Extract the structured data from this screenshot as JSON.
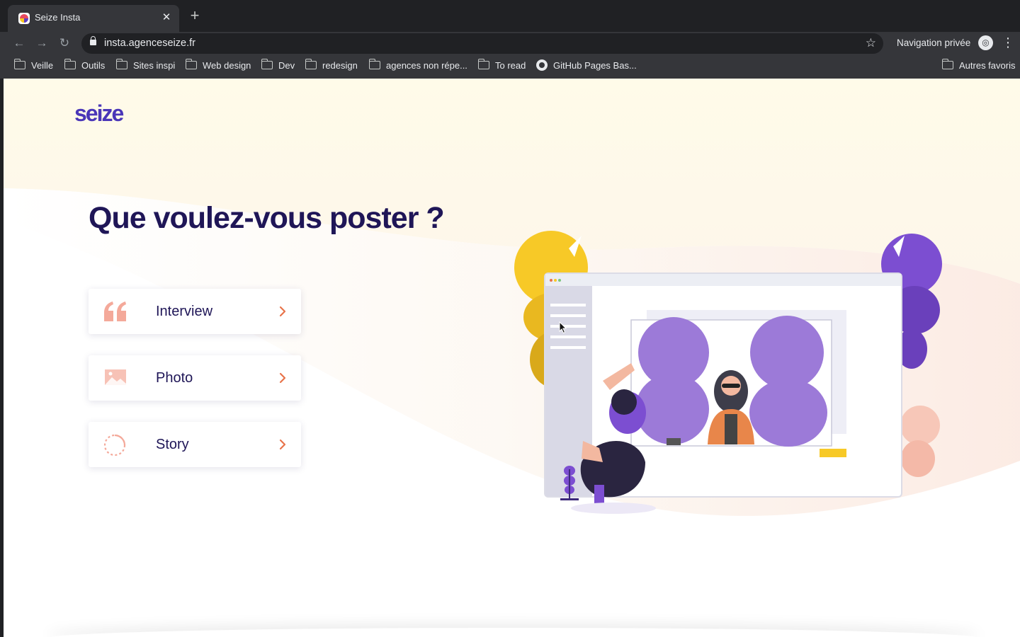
{
  "browser": {
    "tab": {
      "title": "Seize Insta",
      "close_glyph": "✕"
    },
    "new_tab_glyph": "+",
    "nav": {
      "back_glyph": "←",
      "forward_glyph": "→",
      "reload_glyph": "↻"
    },
    "address": {
      "url": "insta.agenceseize.fr",
      "bookmark_glyph": "☆"
    },
    "profile": {
      "label": "Navigation privée",
      "icon_glyph": "◎"
    },
    "menu_glyph": "⋮",
    "bookmarks": [
      {
        "label": "Veille",
        "icon": "folder-icon"
      },
      {
        "label": "Outils",
        "icon": "folder-icon"
      },
      {
        "label": "Sites inspi",
        "icon": "folder-icon"
      },
      {
        "label": "Web design",
        "icon": "folder-icon"
      },
      {
        "label": "Dev",
        "icon": "folder-icon"
      },
      {
        "label": "redesign",
        "icon": "folder-icon"
      },
      {
        "label": "agences non répe...",
        "icon": "folder-icon"
      },
      {
        "label": "To read",
        "icon": "folder-icon"
      },
      {
        "label": "GitHub Pages Bas...",
        "icon": "github-icon"
      }
    ],
    "other_bookmarks": {
      "label": "Autres favoris",
      "icon": "folder-icon"
    }
  },
  "page": {
    "logo": "seize",
    "heading": "Que voulez-vous poster ?",
    "options": [
      {
        "label": "Interview",
        "icon": "quote-icon"
      },
      {
        "label": "Photo",
        "icon": "image-icon"
      },
      {
        "label": "Story",
        "icon": "story-ring-icon"
      }
    ],
    "colors": {
      "brand_purple": "#5b3fc4",
      "heading_navy": "#1f1657",
      "accent_orange": "#e8734a",
      "icon_salmon": "#f4a99a",
      "bg_cream": "#fffbea",
      "illus_yellow": "#f7c927",
      "illus_purple": "#7c4ed1"
    }
  }
}
